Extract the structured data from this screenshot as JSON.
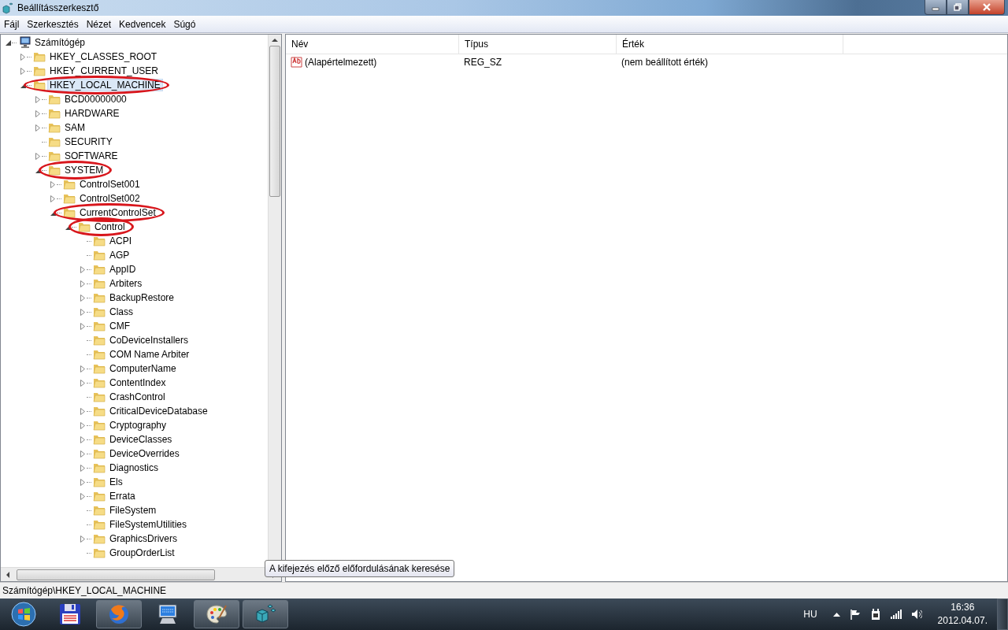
{
  "window": {
    "title": "Beállításszerkesztő"
  },
  "menu": [
    "Fájl",
    "Szerkesztés",
    "Nézet",
    "Kedvencek",
    "Súgó"
  ],
  "tree": [
    {
      "label": "Számítógép",
      "kind": "computer",
      "expanded": true,
      "selected": false,
      "circled": false,
      "children": [
        {
          "label": "HKEY_CLASSES_ROOT",
          "kind": "branch",
          "expanded": false,
          "selected": false,
          "circled": false
        },
        {
          "label": "HKEY_CURRENT_USER",
          "kind": "branch",
          "expanded": false,
          "selected": false,
          "circled": false
        },
        {
          "label": "HKEY_LOCAL_MACHINE",
          "kind": "branch",
          "expanded": true,
          "selected": true,
          "circled": true,
          "children": [
            {
              "label": "BCD00000000",
              "kind": "branch",
              "expanded": false,
              "selected": false,
              "circled": false
            },
            {
              "label": "HARDWARE",
              "kind": "branch",
              "expanded": false,
              "selected": false,
              "circled": false
            },
            {
              "label": "SAM",
              "kind": "branch",
              "expanded": false,
              "selected": false,
              "circled": false
            },
            {
              "label": "SECURITY",
              "kind": "leaf",
              "expanded": false,
              "selected": false,
              "circled": false
            },
            {
              "label": "SOFTWARE",
              "kind": "branch",
              "expanded": false,
              "selected": false,
              "circled": false
            },
            {
              "label": "SYSTEM",
              "kind": "branch",
              "expanded": true,
              "selected": false,
              "circled": true,
              "children": [
                {
                  "label": "ControlSet001",
                  "kind": "branch",
                  "expanded": false,
                  "selected": false,
                  "circled": false
                },
                {
                  "label": "ControlSet002",
                  "kind": "branch",
                  "expanded": false,
                  "selected": false,
                  "circled": false
                },
                {
                  "label": "CurrentControlSet",
                  "kind": "branch",
                  "expanded": true,
                  "selected": false,
                  "circled": true,
                  "children": [
                    {
                      "label": "Control",
                      "kind": "branch",
                      "expanded": true,
                      "selected": false,
                      "circled": true,
                      "children": [
                        {
                          "label": "ACPI",
                          "kind": "leaf",
                          "expanded": false,
                          "selected": false,
                          "circled": false
                        },
                        {
                          "label": "AGP",
                          "kind": "leaf",
                          "expanded": false,
                          "selected": false,
                          "circled": false
                        },
                        {
                          "label": "AppID",
                          "kind": "branch",
                          "expanded": false,
                          "selected": false,
                          "circled": false
                        },
                        {
                          "label": "Arbiters",
                          "kind": "branch",
                          "expanded": false,
                          "selected": false,
                          "circled": false
                        },
                        {
                          "label": "BackupRestore",
                          "kind": "branch",
                          "expanded": false,
                          "selected": false,
                          "circled": false
                        },
                        {
                          "label": "Class",
                          "kind": "branch",
                          "expanded": false,
                          "selected": false,
                          "circled": false
                        },
                        {
                          "label": "CMF",
                          "kind": "branch",
                          "expanded": false,
                          "selected": false,
                          "circled": false
                        },
                        {
                          "label": "CoDeviceInstallers",
                          "kind": "leaf",
                          "expanded": false,
                          "selected": false,
                          "circled": false
                        },
                        {
                          "label": "COM Name Arbiter",
                          "kind": "leaf",
                          "expanded": false,
                          "selected": false,
                          "circled": false
                        },
                        {
                          "label": "ComputerName",
                          "kind": "branch",
                          "expanded": false,
                          "selected": false,
                          "circled": false
                        },
                        {
                          "label": "ContentIndex",
                          "kind": "branch",
                          "expanded": false,
                          "selected": false,
                          "circled": false
                        },
                        {
                          "label": "CrashControl",
                          "kind": "leaf",
                          "expanded": false,
                          "selected": false,
                          "circled": false
                        },
                        {
                          "label": "CriticalDeviceDatabase",
                          "kind": "branch",
                          "expanded": false,
                          "selected": false,
                          "circled": false
                        },
                        {
                          "label": "Cryptography",
                          "kind": "branch",
                          "expanded": false,
                          "selected": false,
                          "circled": false
                        },
                        {
                          "label": "DeviceClasses",
                          "kind": "branch",
                          "expanded": false,
                          "selected": false,
                          "circled": false
                        },
                        {
                          "label": "DeviceOverrides",
                          "kind": "branch",
                          "expanded": false,
                          "selected": false,
                          "circled": false
                        },
                        {
                          "label": "Diagnostics",
                          "kind": "branch",
                          "expanded": false,
                          "selected": false,
                          "circled": false
                        },
                        {
                          "label": "Els",
                          "kind": "branch",
                          "expanded": false,
                          "selected": false,
                          "circled": false
                        },
                        {
                          "label": "Errata",
                          "kind": "branch",
                          "expanded": false,
                          "selected": false,
                          "circled": false
                        },
                        {
                          "label": "FileSystem",
                          "kind": "leaf",
                          "expanded": false,
                          "selected": false,
                          "circled": false
                        },
                        {
                          "label": "FileSystemUtilities",
                          "kind": "leaf",
                          "expanded": false,
                          "selected": false,
                          "circled": false
                        },
                        {
                          "label": "GraphicsDrivers",
                          "kind": "branch",
                          "expanded": false,
                          "selected": false,
                          "circled": false
                        },
                        {
                          "label": "GroupOrderList",
                          "kind": "leaf",
                          "expanded": false,
                          "selected": false,
                          "circled": false
                        }
                      ]
                    }
                  ]
                }
              ]
            }
          ]
        }
      ]
    }
  ],
  "table": {
    "columns": [
      "Név",
      "Típus",
      "Érték"
    ],
    "rows": [
      {
        "name": "(Alapértelmezett)",
        "type": "REG_SZ",
        "value": "(nem beállított érték)"
      }
    ]
  },
  "tooltip": "A kifejezés előző előfordulásának keresése",
  "status_bar": "Számítógép\\HKEY_LOCAL_MACHINE",
  "taskbar": {
    "apps": [
      {
        "kind": "floppy",
        "active": false
      },
      {
        "kind": "globe",
        "active": true
      },
      {
        "kind": "monitor",
        "active": false
      },
      {
        "kind": "palette",
        "active": true
      },
      {
        "kind": "cubes",
        "active": true
      }
    ],
    "language": "HU",
    "time": "16:36",
    "date": "2012.04.07."
  }
}
